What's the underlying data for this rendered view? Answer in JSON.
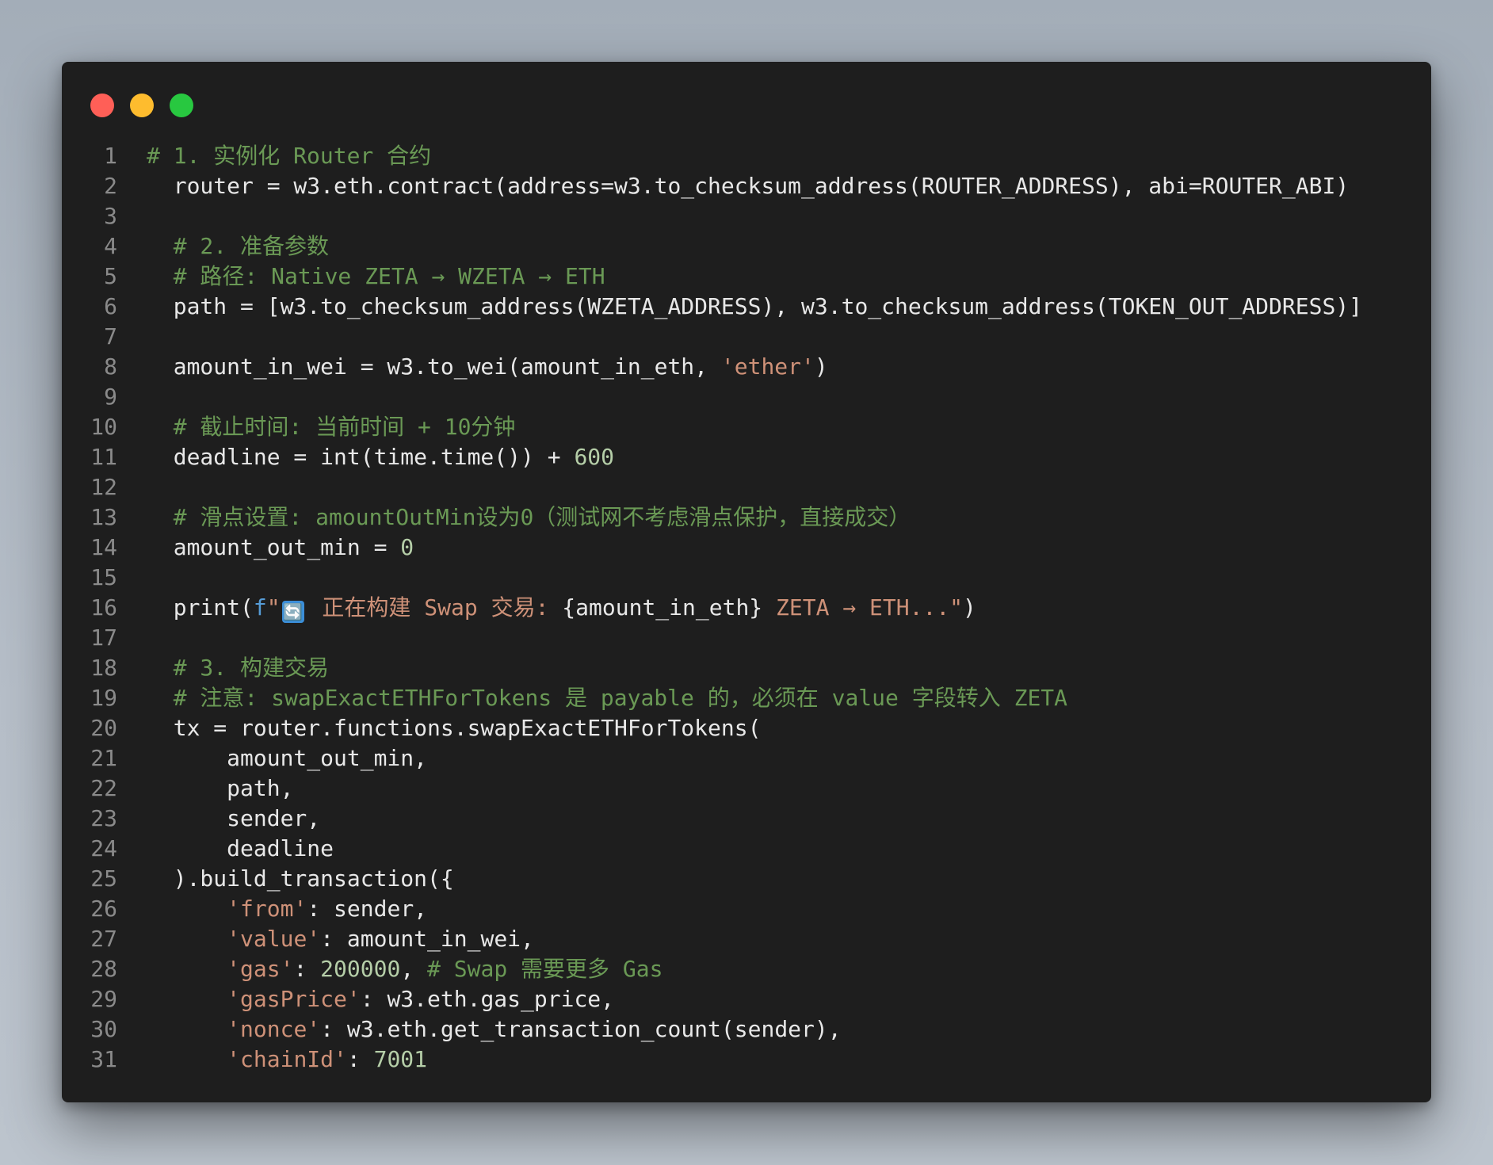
{
  "window": {
    "traffic_lights": [
      {
        "name": "close-dot",
        "color": "#ff5f57"
      },
      {
        "name": "minimize-dot",
        "color": "#febc2e"
      },
      {
        "name": "maximize-dot",
        "color": "#28c840"
      }
    ]
  },
  "theme": {
    "background": "#1e1e1e",
    "comment": "#6a9955",
    "string": "#ce9178",
    "number": "#b5cea8",
    "plain": "#e8e8e8",
    "line_number": "#8a8a8a"
  },
  "code": {
    "lines": [
      {
        "n": "1",
        "tokens": [
          {
            "t": "comment",
            "v": "# 1. 实例化 Router 合约"
          }
        ]
      },
      {
        "n": "2",
        "tokens": [
          {
            "t": "plain",
            "v": "  router = w3.eth.contract(address=w3.to_checksum_address(ROUTER_ADDRESS), abi=ROUTER_ABI)"
          }
        ]
      },
      {
        "n": "3",
        "tokens": []
      },
      {
        "n": "4",
        "tokens": [
          {
            "t": "plain",
            "v": "  "
          },
          {
            "t": "comment",
            "v": "# 2. 准备参数"
          }
        ]
      },
      {
        "n": "5",
        "tokens": [
          {
            "t": "plain",
            "v": "  "
          },
          {
            "t": "comment",
            "v": "# 路径: Native ZETA → WZETA → ETH"
          }
        ]
      },
      {
        "n": "6",
        "tokens": [
          {
            "t": "plain",
            "v": "  path = [w3.to_checksum_address(WZETA_ADDRESS), w3.to_checksum_address(TOKEN_OUT_ADDRESS)]"
          }
        ]
      },
      {
        "n": "7",
        "tokens": []
      },
      {
        "n": "8",
        "tokens": [
          {
            "t": "plain",
            "v": "  amount_in_wei = w3.to_wei(amount_in_eth, "
          },
          {
            "t": "string",
            "v": "'ether'"
          },
          {
            "t": "plain",
            "v": ")"
          }
        ]
      },
      {
        "n": "9",
        "tokens": []
      },
      {
        "n": "10",
        "tokens": [
          {
            "t": "plain",
            "v": "  "
          },
          {
            "t": "comment",
            "v": "# 截止时间: 当前时间 + 10分钟"
          }
        ]
      },
      {
        "n": "11",
        "tokens": [
          {
            "t": "plain",
            "v": "  deadline = int(time.time()) + "
          },
          {
            "t": "number",
            "v": "600"
          }
        ]
      },
      {
        "n": "12",
        "tokens": []
      },
      {
        "n": "13",
        "tokens": [
          {
            "t": "plain",
            "v": "  "
          },
          {
            "t": "comment",
            "v": "# 滑点设置: amountOutMin设为0（测试网不考虑滑点保护，直接成交）"
          }
        ]
      },
      {
        "n": "14",
        "tokens": [
          {
            "t": "plain",
            "v": "  amount_out_min = "
          },
          {
            "t": "number",
            "v": "0"
          }
        ]
      },
      {
        "n": "15",
        "tokens": []
      },
      {
        "n": "16",
        "tokens": [
          {
            "t": "plain",
            "v": "  print("
          },
          {
            "t": "fstr",
            "v": "f"
          },
          {
            "t": "string",
            "v": "\""
          },
          {
            "t": "emoji",
            "v": "🔄"
          },
          {
            "t": "string",
            "v": " 正在构建 Swap 交易: "
          },
          {
            "t": "plain",
            "v": "{amount_in_eth}"
          },
          {
            "t": "string",
            "v": " ZETA → ETH...\""
          },
          {
            "t": "plain",
            "v": ")"
          }
        ]
      },
      {
        "n": "17",
        "tokens": []
      },
      {
        "n": "18",
        "tokens": [
          {
            "t": "plain",
            "v": "  "
          },
          {
            "t": "comment",
            "v": "# 3. 构建交易"
          }
        ]
      },
      {
        "n": "19",
        "tokens": [
          {
            "t": "plain",
            "v": "  "
          },
          {
            "t": "comment",
            "v": "# 注意: swapExactETHForTokens 是 payable 的，必须在 value 字段转入 ZETA"
          }
        ]
      },
      {
        "n": "20",
        "tokens": [
          {
            "t": "plain",
            "v": "  tx = router.functions.swapExactETHForTokens("
          }
        ]
      },
      {
        "n": "21",
        "tokens": [
          {
            "t": "plain",
            "v": "      amount_out_min,"
          }
        ]
      },
      {
        "n": "22",
        "tokens": [
          {
            "t": "plain",
            "v": "      path,"
          }
        ]
      },
      {
        "n": "23",
        "tokens": [
          {
            "t": "plain",
            "v": "      sender,"
          }
        ]
      },
      {
        "n": "24",
        "tokens": [
          {
            "t": "plain",
            "v": "      deadline"
          }
        ]
      },
      {
        "n": "25",
        "tokens": [
          {
            "t": "plain",
            "v": "  ).build_transaction({"
          }
        ]
      },
      {
        "n": "26",
        "tokens": [
          {
            "t": "plain",
            "v": "      "
          },
          {
            "t": "string",
            "v": "'from'"
          },
          {
            "t": "plain",
            "v": ": sender,"
          }
        ]
      },
      {
        "n": "27",
        "tokens": [
          {
            "t": "plain",
            "v": "      "
          },
          {
            "t": "string",
            "v": "'value'"
          },
          {
            "t": "plain",
            "v": ": amount_in_wei,"
          }
        ]
      },
      {
        "n": "28",
        "tokens": [
          {
            "t": "plain",
            "v": "      "
          },
          {
            "t": "string",
            "v": "'gas'"
          },
          {
            "t": "plain",
            "v": ": "
          },
          {
            "t": "number",
            "v": "200000"
          },
          {
            "t": "plain",
            "v": ", "
          },
          {
            "t": "comment",
            "v": "# Swap 需要更多 Gas"
          }
        ]
      },
      {
        "n": "29",
        "tokens": [
          {
            "t": "plain",
            "v": "      "
          },
          {
            "t": "string",
            "v": "'gasPrice'"
          },
          {
            "t": "plain",
            "v": ": w3.eth.gas_price,"
          }
        ]
      },
      {
        "n": "30",
        "tokens": [
          {
            "t": "plain",
            "v": "      "
          },
          {
            "t": "string",
            "v": "'nonce'"
          },
          {
            "t": "plain",
            "v": ": w3.eth.get_transaction_count(sender),"
          }
        ]
      },
      {
        "n": "31",
        "tokens": [
          {
            "t": "plain",
            "v": "      "
          },
          {
            "t": "string",
            "v": "'chainId'"
          },
          {
            "t": "plain",
            "v": ": "
          },
          {
            "t": "number",
            "v": "7001"
          }
        ]
      }
    ]
  }
}
